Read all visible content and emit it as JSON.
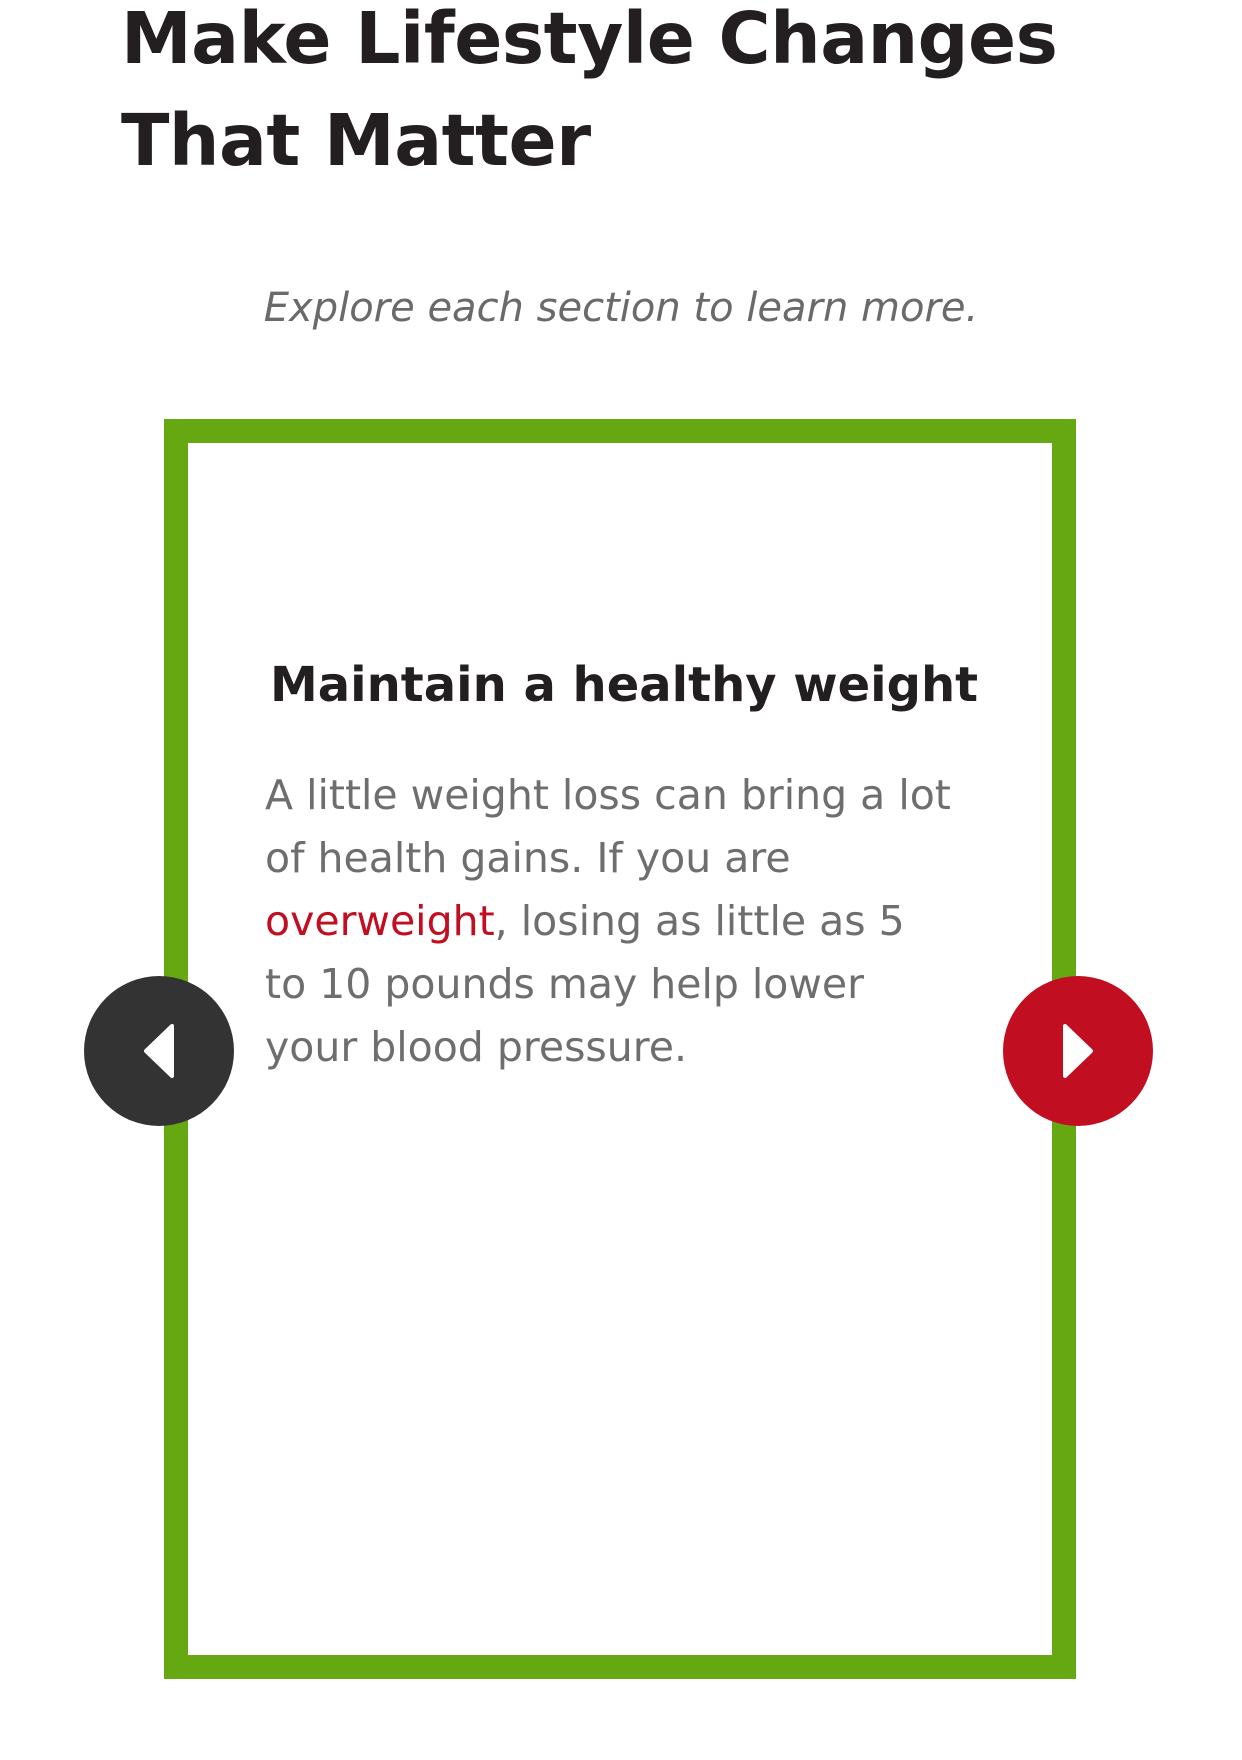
{
  "page": {
    "title_line1": "Make Lifestyle Changes",
    "title_line2": "That Matter",
    "subtitle": "Explore each section to learn more."
  },
  "carousel": {
    "card": {
      "heading": "Maintain a healthy weight",
      "body_before_link": "A little weight loss can bring a lot of health gains. If you are ",
      "link_text": "overweight",
      "body_after_link": ", losing as little as 5 to 10 pounds may help lower your blood pressure."
    },
    "prev_icon": "chevron-left-icon",
    "next_icon": "chevron-right-icon"
  },
  "colors": {
    "card_border": "#65a812",
    "link": "#c10e21",
    "next_button": "#c10e21",
    "prev_button": "#333333",
    "heading_text": "#231f20",
    "body_text": "#6e6e6e"
  }
}
